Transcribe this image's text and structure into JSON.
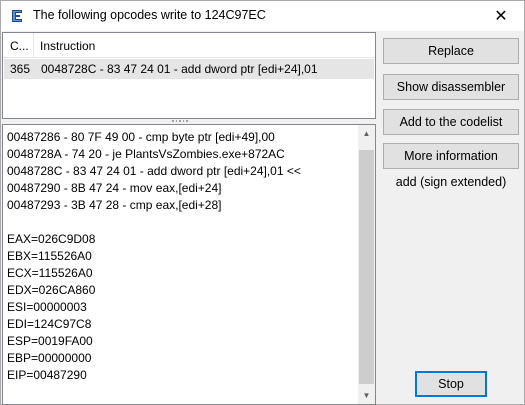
{
  "window": {
    "title": "The following opcodes write to 124C97EC",
    "close_glyph": "✕"
  },
  "list": {
    "headers": [
      "C...",
      "Instruction"
    ],
    "rows": [
      {
        "count": "365",
        "instruction": "0048728C - 83 47 24 01 - add dword ptr [edi+24],01"
      }
    ]
  },
  "memo": {
    "lines": [
      "00487286 - 80 7F 49 00 - cmp byte ptr [edi+49],00",
      "0048728A - 74 20 - je PlantsVsZombies.exe+872AC",
      "0048728C - 83 47 24 01 - add dword ptr [edi+24],01 <<",
      "00487290 - 8B 47 24  - mov eax,[edi+24]",
      "00487293 - 3B 47 28  - cmp eax,[edi+28]",
      "",
      "EAX=026C9D08",
      "EBX=115526A0",
      "ECX=115526A0",
      "EDX=026CA860",
      "ESI=00000003",
      "EDI=124C97C8",
      "ESP=0019FA00",
      "EBP=00000000",
      "EIP=00487290"
    ]
  },
  "buttons": {
    "replace": "Replace",
    "show_disassembler": "Show disassembler",
    "add_to_codelist": "Add to the codelist",
    "more_information": "More information",
    "stop": "Stop"
  },
  "description": "add (sign extended)",
  "icons": {
    "app": "cheat-engine-icon",
    "close": "close-icon"
  },
  "colors": {
    "selected_row": "#e5e5e5",
    "button_face": "#e1e1e1",
    "focus_border": "#0078d7"
  }
}
